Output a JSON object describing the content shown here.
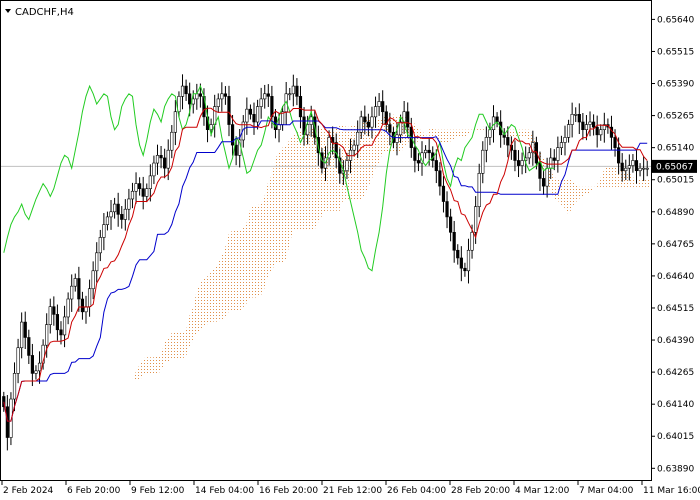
{
  "chart_data": {
    "type": "candlestick",
    "title": "CADCHF,H4",
    "current_price_label": "0.65067",
    "current_price": 0.65067,
    "ylim": [
      0.6386,
      0.657
    ],
    "y_ticks": [
      "0.65640",
      "0.65515",
      "0.65390",
      "0.65265",
      "0.65140",
      "0.65015",
      "0.64890",
      "0.64765",
      "0.64640",
      "0.64515",
      "0.64390",
      "0.64265",
      "0.64140",
      "0.64015",
      "0.63890"
    ],
    "x_ticks": [
      "2 Feb 2024",
      "6 Feb 20:00",
      "9 Feb 12:00",
      "14 Feb 04:00",
      "16 Feb 20:00",
      "21 Feb 12:00",
      "26 Feb 04:00",
      "28 Feb 20:00",
      "4 Mar 12:00",
      "7 Mar 04:00",
      "11 Mar 16:00"
    ],
    "grid": false,
    "colors": {
      "candle": "#000000",
      "tenkan_sen": "#cc0000",
      "kijun_sen": "#0000cc",
      "chikou_span": "#22cc22",
      "kumo_hatch": "#e0904a",
      "current_price_line": "#c0c0c0"
    },
    "close": [
      0.6413,
      0.6401,
      0.6416,
      0.6426,
      0.6436,
      0.6446,
      0.644,
      0.6433,
      0.6426,
      0.6427,
      0.643,
      0.6437,
      0.6445,
      0.6452,
      0.6449,
      0.6443,
      0.6441,
      0.6448,
      0.6455,
      0.646,
      0.6463,
      0.6455,
      0.645,
      0.6452,
      0.6459,
      0.6466,
      0.6473,
      0.6479,
      0.6484,
      0.6487,
      0.6489,
      0.6492,
      0.6488,
      0.6486,
      0.649,
      0.6494,
      0.6497,
      0.65,
      0.6498,
      0.6495,
      0.6498,
      0.6503,
      0.6508,
      0.6511,
      0.651,
      0.6506,
      0.6513,
      0.652,
      0.6528,
      0.6534,
      0.6538,
      0.6535,
      0.6531,
      0.6533,
      0.6535,
      0.6534,
      0.6526,
      0.6521,
      0.6523,
      0.653,
      0.6533,
      0.6535,
      0.6534,
      0.6523,
      0.6515,
      0.6511,
      0.6517,
      0.6524,
      0.6529,
      0.6527,
      0.6524,
      0.653,
      0.6533,
      0.6535,
      0.6534,
      0.6526,
      0.6521,
      0.6523,
      0.6528,
      0.6535,
      0.6535,
      0.6538,
      0.6534,
      0.6526,
      0.6519,
      0.6523,
      0.6526,
      0.6518,
      0.6512,
      0.6506,
      0.651,
      0.6518,
      0.6516,
      0.651,
      0.6504,
      0.6505,
      0.6509,
      0.6513,
      0.6515,
      0.652,
      0.6526,
      0.6524,
      0.6522,
      0.6526,
      0.653,
      0.6532,
      0.6528,
      0.6523,
      0.652,
      0.6516,
      0.6519,
      0.6524,
      0.6528,
      0.6522,
      0.6514,
      0.6509,
      0.6508,
      0.6512,
      0.6513,
      0.6512,
      0.6509,
      0.6505,
      0.6499,
      0.6493,
      0.6487,
      0.6481,
      0.6474,
      0.6471,
      0.6467,
      0.6466,
      0.6474,
      0.6481,
      0.6491,
      0.6504,
      0.6513,
      0.6518,
      0.6521,
      0.6526,
      0.6524,
      0.6519,
      0.6518,
      0.6515,
      0.6513,
      0.6509,
      0.6507,
      0.6509,
      0.651,
      0.6512,
      0.6516,
      0.6508,
      0.6502,
      0.6499,
      0.6506,
      0.651,
      0.6509,
      0.6514,
      0.6516,
      0.6518,
      0.6523,
      0.6527,
      0.6527,
      0.6524,
      0.6521,
      0.6523,
      0.6524,
      0.6522,
      0.6519,
      0.6521,
      0.6523,
      0.6522,
      0.6518,
      0.6514,
      0.6508,
      0.6505,
      0.6506,
      0.6507,
      0.6509,
      0.6505,
      0.6506,
      0.6506,
      0.6506
    ]
  }
}
